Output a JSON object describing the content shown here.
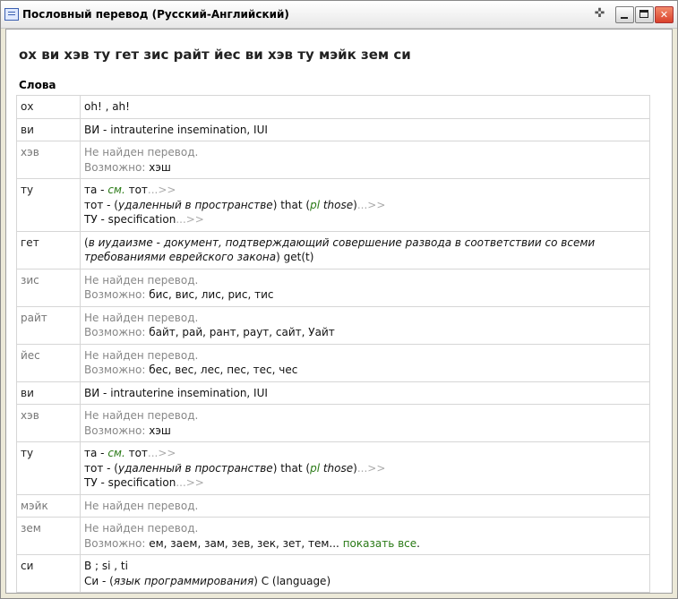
{
  "window": {
    "title": "Пословный перевод (Русский-Английский)",
    "pin_glyph": "✜",
    "close_glyph": "✕"
  },
  "heading": "ох ви хэв ту гет зис райт йес ви хэв ту мэйк зем си",
  "section_label": "Слова",
  "not_found": "Не найден перевод.",
  "maybe": "Возможно:",
  "more": "...>>",
  "rows": [
    {
      "word": "ох",
      "found": true,
      "l1": "oh! , ah!"
    },
    {
      "word": "ви",
      "found": true,
      "abbr": "ВИ",
      "sep": " - ",
      "tr": "intrauterine insemination, IUI"
    },
    {
      "word": "хэв",
      "found": false,
      "suggest": "хэш"
    },
    {
      "word": "ту",
      "found": true,
      "a_word": "та",
      "a_sep": " - ",
      "a_see": "см.",
      "a_target": " тот",
      "b_word": "тот",
      "b_sep": " - (",
      "b_note": "удаленный в пространстве",
      "b_tr": ") that (",
      "b_pl": "pl",
      "b_those": " those",
      "b_close": ")",
      "c_word": "ТУ",
      "c_sep": " - ",
      "c_tr": "specification"
    },
    {
      "word": "гет",
      "found": true,
      "l_open": "(",
      "l_note": "в иудаизме - документ, подтверждающий совершение развода в соответствии со всеми требованиями еврейского закона",
      "l_close": ") get(t)"
    },
    {
      "word": "зис",
      "found": false,
      "suggest": "бис, вис, лис, рис, тис"
    },
    {
      "word": "райт",
      "found": false,
      "suggest": "байт, рай, рант, раут, сайт, Уайт"
    },
    {
      "word": "йес",
      "found": false,
      "suggest": "бес, вес, лес, пес, тес, чес"
    },
    {
      "word": "ви",
      "found": true,
      "abbr": "ВИ",
      "sep": " - ",
      "tr": "intrauterine insemination, IUI"
    },
    {
      "word": "хэв",
      "found": false,
      "suggest": "хэш"
    },
    {
      "word": "ту",
      "found": true,
      "a_word": "та",
      "a_sep": " - ",
      "a_see": "см.",
      "a_target": " тот",
      "b_word": "тот",
      "b_sep": " - (",
      "b_note": "удаленный в пространстве",
      "b_tr": ") that (",
      "b_pl": "pl",
      "b_those": " those",
      "b_close": ")",
      "c_word": "ТУ",
      "c_sep": " - ",
      "c_tr": "specification"
    },
    {
      "word": "мэйк",
      "found": false
    },
    {
      "word": "зем",
      "found": false,
      "suggest": "ем, заем, зам, зев, зек, зет, тем...",
      "show_all": "показать все",
      "end": "."
    },
    {
      "word": "си",
      "found": true,
      "l1": "В ; si , ti",
      "b_word": "Си",
      "b_sep": " - (",
      "b_note": "язык программирования",
      "b_tr": ") C (language)"
    }
  ]
}
